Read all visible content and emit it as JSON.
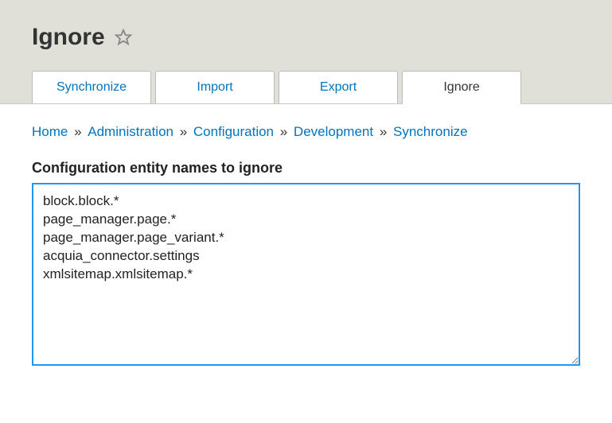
{
  "header": {
    "title": "Ignore"
  },
  "tabs": [
    {
      "label": "Synchronize",
      "active": false
    },
    {
      "label": "Import",
      "active": false
    },
    {
      "label": "Export",
      "active": false
    },
    {
      "label": "Ignore",
      "active": true
    }
  ],
  "breadcrumb": {
    "items": [
      "Home",
      "Administration",
      "Configuration",
      "Development",
      "Synchronize"
    ],
    "separator": "»"
  },
  "form": {
    "label": "Configuration entity names to ignore",
    "value": "block.block.*\npage_manager.page.*\npage_manager.page_variant.*\nacquia_connector.settings\nxmlsitemap.xmlsitemap.*\n"
  }
}
